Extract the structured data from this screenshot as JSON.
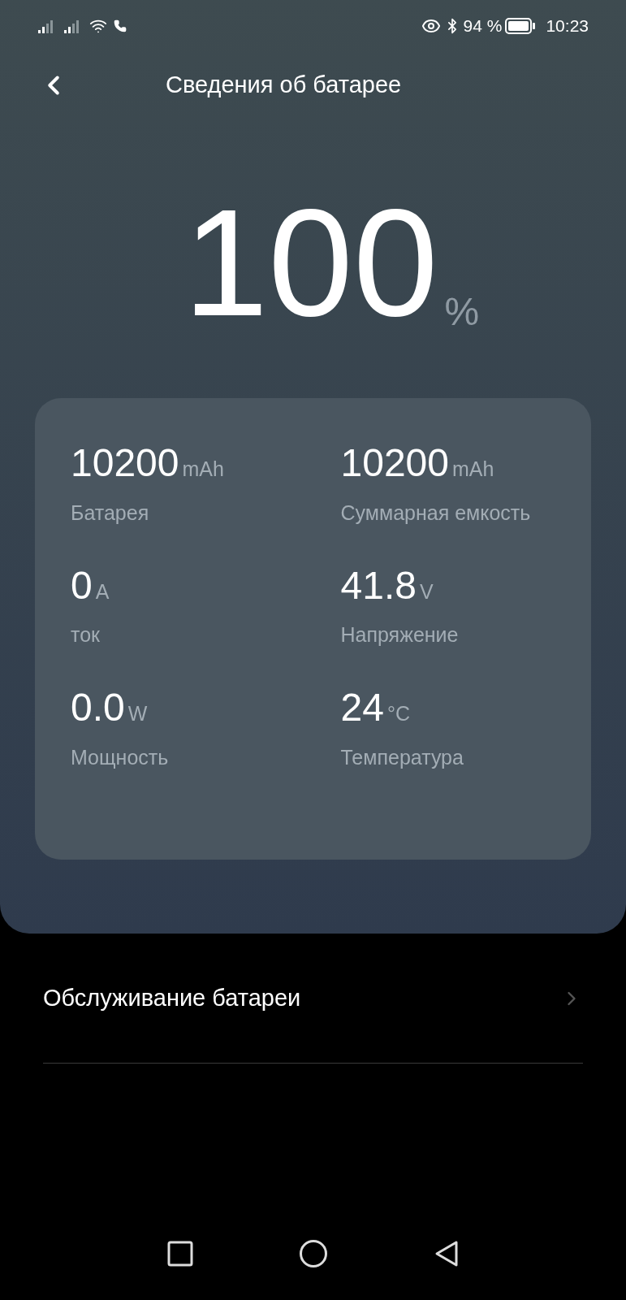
{
  "status_bar": {
    "battery": "94 %",
    "time": "10:23"
  },
  "header": {
    "title": "Сведения об батарее"
  },
  "charge": {
    "value": "100",
    "unit": "%"
  },
  "stats": [
    {
      "value": "10200",
      "unit": "mAh",
      "label": "Батарея"
    },
    {
      "value": "10200",
      "unit": "mAh",
      "label": "Суммарная емкость"
    },
    {
      "value": "0",
      "unit": "A",
      "label": "ток"
    },
    {
      "value": "41.8",
      "unit": "V",
      "label": "Напряжение"
    },
    {
      "value": "0.0",
      "unit": "W",
      "label": "Мощность"
    },
    {
      "value": "24",
      "unit": "°C",
      "label": "Температура"
    }
  ],
  "menu": [
    {
      "label": "Обслуживание батареи"
    }
  ]
}
